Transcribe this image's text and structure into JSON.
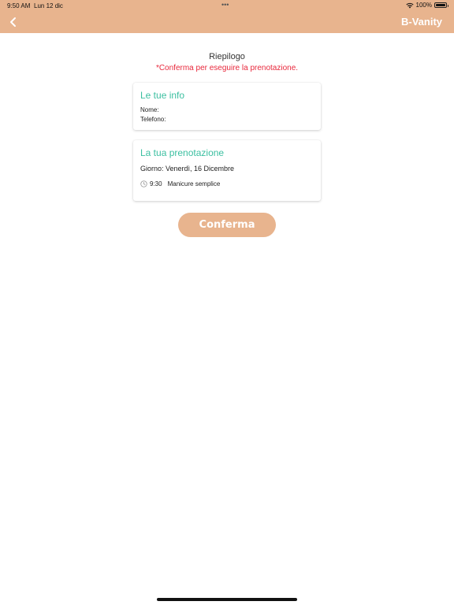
{
  "status_bar": {
    "time": "9:50 AM",
    "date": "Lun 12 dic",
    "dots": "•••",
    "battery_text": "100%"
  },
  "nav": {
    "back_icon": "chevron-left-icon",
    "brand": "B-Vanity",
    "background_color": "#e8b48e"
  },
  "summary": {
    "title": "Riepilogo",
    "subtitle": "*Conferma per eseguire la prenotazione."
  },
  "info_card": {
    "heading": "Le tue info",
    "name_label": "Nome:",
    "phone_label": "Telefono:"
  },
  "booking_card": {
    "heading": "La tua prenotazione",
    "day": "Giorno: Venerdì, 16 Dicembre",
    "time": "9:30",
    "service": "Manicure semplice",
    "clock_icon": "clock-icon"
  },
  "actions": {
    "confirm_label": "Conferma"
  },
  "colors": {
    "accent": "#e8b48e",
    "heading": "#3bbfa0",
    "warning": "#e8283c"
  }
}
